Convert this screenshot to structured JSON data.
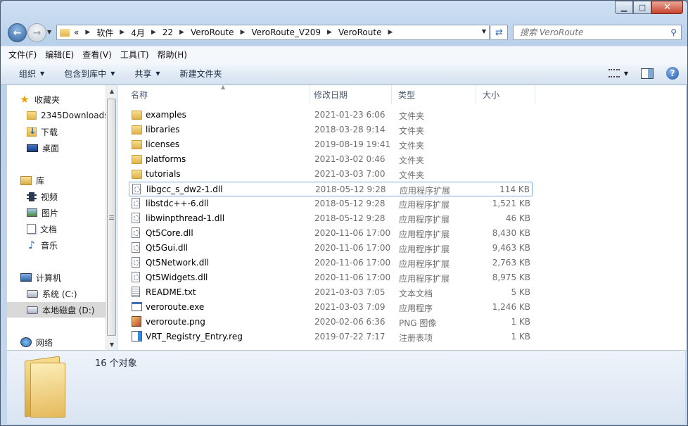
{
  "window": {
    "caption": {
      "minimize": "▁",
      "maximize": "□",
      "close": "✕"
    }
  },
  "address": {
    "overflow": "«",
    "crumbs": [
      "软件",
      "4月",
      "22",
      "VeroRoute",
      "VeroRoute_V209",
      "VeroRoute"
    ]
  },
  "search": {
    "placeholder": "搜索 VeroRoute"
  },
  "menu": [
    "文件(F)",
    "编辑(E)",
    "查看(V)",
    "工具(T)",
    "帮助(H)"
  ],
  "commands": [
    "组织",
    "包含到库中",
    "共享",
    "新建文件夹"
  ],
  "nav": {
    "favorites": "收藏夹",
    "favorites_items": [
      "2345Downloads",
      "下载",
      "桌面"
    ],
    "library": "库",
    "library_items": [
      "视频",
      "图片",
      "文档",
      "音乐"
    ],
    "computer": "计算机",
    "computer_items": [
      "系统 (C:)",
      "本地磁盘 (D:)"
    ],
    "network": "网络"
  },
  "columns": {
    "name": "名称",
    "date": "修改日期",
    "type": "类型",
    "size": "大小"
  },
  "files": [
    {
      "name": "examples",
      "date": "2021-01-23 6:06",
      "type": "文件夹",
      "size": "",
      "icon": "folder"
    },
    {
      "name": "libraries",
      "date": "2018-03-28 9:14",
      "type": "文件夹",
      "size": "",
      "icon": "folder"
    },
    {
      "name": "licenses",
      "date": "2019-08-19 19:41",
      "type": "文件夹",
      "size": "",
      "icon": "folder"
    },
    {
      "name": "platforms",
      "date": "2021-03-02 0:46",
      "type": "文件夹",
      "size": "",
      "icon": "folder"
    },
    {
      "name": "tutorials",
      "date": "2021-03-03 7:00",
      "type": "文件夹",
      "size": "",
      "icon": "folder"
    },
    {
      "name": "libgcc_s_dw2-1.dll",
      "date": "2018-05-12 9:28",
      "type": "应用程序扩展",
      "size": "114 KB",
      "icon": "dll"
    },
    {
      "name": "libstdc++-6.dll",
      "date": "2018-05-12 9:28",
      "type": "应用程序扩展",
      "size": "1,521 KB",
      "icon": "dll"
    },
    {
      "name": "libwinpthread-1.dll",
      "date": "2018-05-12 9:28",
      "type": "应用程序扩展",
      "size": "46 KB",
      "icon": "dll"
    },
    {
      "name": "Qt5Core.dll",
      "date": "2020-11-06 17:00",
      "type": "应用程序扩展",
      "size": "8,430 KB",
      "icon": "dll"
    },
    {
      "name": "Qt5Gui.dll",
      "date": "2020-11-06 17:00",
      "type": "应用程序扩展",
      "size": "9,463 KB",
      "icon": "dll"
    },
    {
      "name": "Qt5Network.dll",
      "date": "2020-11-06 17:00",
      "type": "应用程序扩展",
      "size": "2,763 KB",
      "icon": "dll"
    },
    {
      "name": "Qt5Widgets.dll",
      "date": "2020-11-06 17:00",
      "type": "应用程序扩展",
      "size": "8,975 KB",
      "icon": "dll"
    },
    {
      "name": "README.txt",
      "date": "2021-03-03 7:05",
      "type": "文本文档",
      "size": "5 KB",
      "icon": "txt"
    },
    {
      "name": "veroroute.exe",
      "date": "2021-03-03 7:09",
      "type": "应用程序",
      "size": "1,246 KB",
      "icon": "exe"
    },
    {
      "name": "veroroute.png",
      "date": "2020-02-06 6:36",
      "type": "PNG 图像",
      "size": "1 KB",
      "icon": "png"
    },
    {
      "name": "VRT_Registry_Entry.reg",
      "date": "2019-07-22 7:17",
      "type": "注册表项",
      "size": "1 KB",
      "icon": "reg"
    }
  ],
  "selected_file": "libgcc_s_dw2-1.dll",
  "details": {
    "count": "16 个对象"
  }
}
